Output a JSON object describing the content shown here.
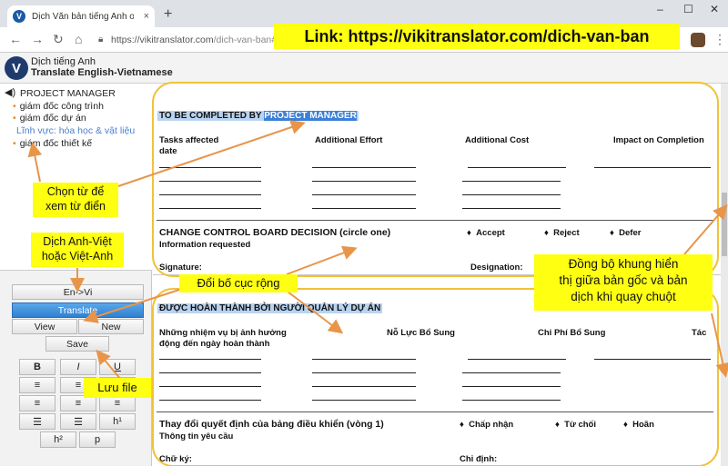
{
  "browser": {
    "tab_title": "Dịch Văn bản tiếng Anh online",
    "tab_close": "×",
    "new_tab": "+",
    "url_host": "https://vikitranslator.com",
    "url_path": "/dich-van-ban#",
    "win_min": "–",
    "win_max": "☐",
    "win_close": "✕"
  },
  "app": {
    "logo_letter": "V",
    "brand_line1": "Dịch tiếng Anh",
    "brand_line2": "Translate English-Vietnamese"
  },
  "dictionary": {
    "heading": "PROJECT MANAGER",
    "items": [
      "giám đốc công trình",
      "giám đốc dự án"
    ],
    "field_label": "Lĩnh vực: hóa học & vật liệu",
    "item3": "giám đốc thiết kế"
  },
  "controls": {
    "direction": "En->Vi",
    "translate": "Translate",
    "view": "View",
    "new": "New",
    "save": "Save",
    "format_buttons": [
      "B",
      "I",
      "U",
      "≡",
      "≡",
      "≡",
      "≡",
      "≡",
      "≡",
      "☰",
      "☰",
      "h¹",
      "h²",
      "p"
    ]
  },
  "original": {
    "heading_prefix": "TO BE COMPLETED BY",
    "heading_selected": "PROJECT MANAGER",
    "col1a": "Tasks affected",
    "col1b": "date",
    "col2": "Additional Effort",
    "col3": "Additional Cost",
    "col4": "Impact on Completion",
    "decision_title": "CHANGE CONTROL BOARD DECISION (circle one)",
    "decision_options": [
      "Accept",
      "Reject",
      "Defer"
    ],
    "info_requested": "Information requested",
    "signature": "Signature:",
    "designation": "Designation:"
  },
  "translated": {
    "heading": "ĐƯỢC HOÀN THÀNH BỞI NGƯỜI QUẢN LÝ DỰ ÁN",
    "col1a": "Những nhiệm vụ bị ảnh hưởng",
    "col1b": "động đến ngày hoàn thành",
    "col2": "Nỗ Lực Bổ Sung",
    "col3": "Chi Phí Bổ Sung",
    "col4": "Tác",
    "decision_title": "Thay đổi quyết định của bảng điều khiển (vòng 1)",
    "decision_options": [
      "Chấp nhận",
      "Từ chối",
      "Hoãn"
    ],
    "info_requested": "Thông tin yêu cầu",
    "signature": "Chữ ký:",
    "designation": "Chỉ định:"
  },
  "annotations": {
    "link": "Link: https://vikitranslator.com/dich-van-ban",
    "choose_word": "Chọn từ để\nxem từ điển",
    "translate_dir": "Dịch Anh-Việt\nhoặc Việt-Anh",
    "layout": "Đổi bố cục rộng",
    "save_file": "Lưu file",
    "sync": "Đồng bộ khung hiển\nthị giữa bản gốc và bản\ndịch khi quay chuột"
  },
  "colors": {
    "annotation_bg": "#ffff12",
    "arrow": "#e8954a",
    "frame": "#f0c23a",
    "selection": "#3b7fd6",
    "highlight": "#b9d3f0"
  }
}
